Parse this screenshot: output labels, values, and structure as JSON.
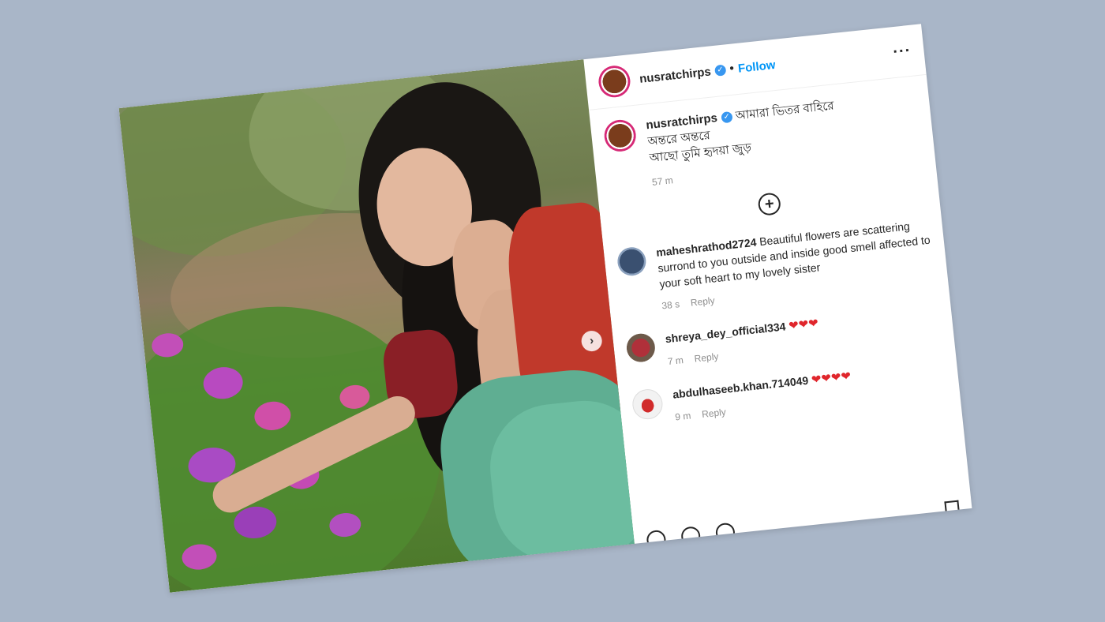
{
  "post": {
    "username": "nusratchirps",
    "verified_icon": "verified-check-icon",
    "dot": "•",
    "follow_label": "Follow",
    "more_icon": "more-options-icon",
    "caption_lines": [
      "আমারা ভিতর বাহিরে",
      "অন্তরে অন্তরে",
      "আছো তুমি হৃদয়া জুড়"
    ],
    "caption_time": "57 m",
    "next_icon": "chevron-right-icon",
    "load_more_icon": "plus-circle-icon"
  },
  "comments": [
    {
      "username": "maheshrathod2724",
      "text": "Beautiful flowers are scattering surrond to you outside and inside good smell affected to your soft heart to my lovely sister",
      "time": "38 s",
      "reply": "Reply"
    },
    {
      "username": "shreya_dey_official334",
      "text": "❤❤❤",
      "time": "7 m",
      "reply": "Reply"
    },
    {
      "username": "abdulhaseeb.khan.714049",
      "text": "❤❤❤❤",
      "time": "9 m",
      "reply": "Reply"
    }
  ],
  "colors": {
    "accent": "#0095f6",
    "verified": "#3897f0",
    "heart": "#e0262c",
    "background": "#a9b6c8"
  }
}
